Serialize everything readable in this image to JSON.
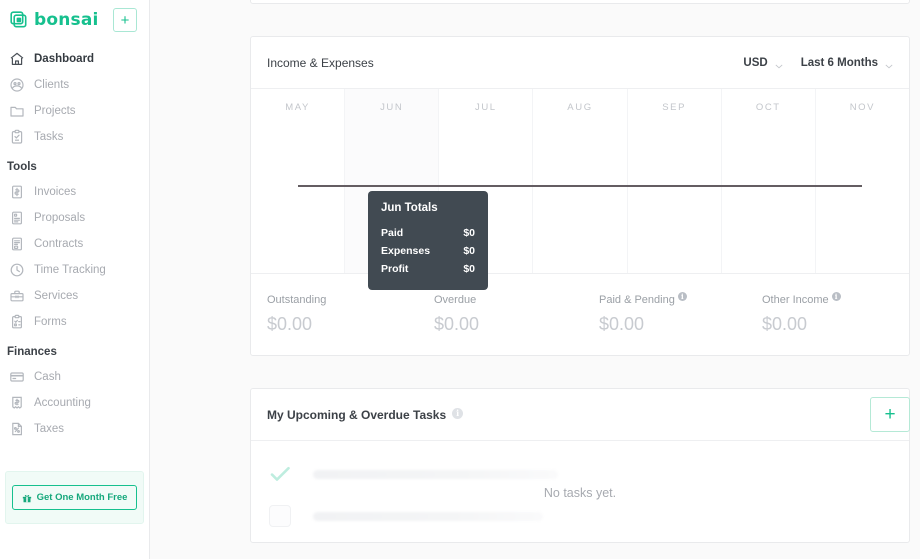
{
  "sidebar": {
    "brand": "bonsai",
    "brand_icon": "bonsai-logo-icon",
    "add_button_label": "+",
    "nav": [
      {
        "label": "Dashboard",
        "icon": "home-icon",
        "active": true
      },
      {
        "label": "Clients",
        "icon": "clients-icon",
        "active": false
      },
      {
        "label": "Projects",
        "icon": "folder-icon",
        "active": false
      },
      {
        "label": "Tasks",
        "icon": "clipboard-check-icon",
        "active": false
      }
    ],
    "tools_title": "Tools",
    "tools": [
      {
        "label": "Invoices",
        "icon": "invoice-icon"
      },
      {
        "label": "Proposals",
        "icon": "proposal-icon"
      },
      {
        "label": "Contracts",
        "icon": "contract-icon"
      },
      {
        "label": "Time Tracking",
        "icon": "clock-icon"
      },
      {
        "label": "Services",
        "icon": "toolbox-icon"
      },
      {
        "label": "Forms",
        "icon": "form-icon"
      }
    ],
    "finances_title": "Finances",
    "finances": [
      {
        "label": "Cash",
        "icon": "credit-card-icon"
      },
      {
        "label": "Accounting",
        "icon": "accounting-icon"
      },
      {
        "label": "Taxes",
        "icon": "tax-percent-icon"
      }
    ],
    "promo_label": "Get One Month Free",
    "promo_icon": "gift-icon"
  },
  "chart_card": {
    "title": "Income & Expenses",
    "currency": "USD",
    "range": "Last 6 Months",
    "currency_caret": "chevron-down-icon",
    "range_caret": "chevron-down-icon",
    "stats": [
      {
        "label": "Outstanding",
        "value": "$0.00",
        "info": false
      },
      {
        "label": "Overdue",
        "value": "$0.00",
        "info": false
      },
      {
        "label": "Paid & Pending",
        "value": "$0.00",
        "info": true
      },
      {
        "label": "Other Income",
        "value": "$0.00",
        "info": true
      }
    ],
    "tooltip": {
      "title": "Jun Totals",
      "rows": [
        {
          "label": "Paid",
          "value": "$0"
        },
        {
          "label": "Expenses",
          "value": "$0"
        },
        {
          "label": "Profit",
          "value": "$0"
        }
      ]
    }
  },
  "chart_data": {
    "type": "bar",
    "title": "Income & Expenses",
    "xlabel": "",
    "ylabel": "",
    "categories": [
      "MAY",
      "JUN",
      "JUL",
      "AUG",
      "SEP",
      "OCT",
      "NOV"
    ],
    "series": [
      {
        "name": "Paid",
        "values": [
          0,
          0,
          0,
          0,
          0,
          0,
          0
        ]
      },
      {
        "name": "Expenses",
        "values": [
          0,
          0,
          0,
          0,
          0,
          0,
          0
        ]
      },
      {
        "name": "Profit",
        "values": [
          0,
          0,
          0,
          0,
          0,
          0,
          0
        ]
      }
    ],
    "ylim": [
      0,
      0
    ],
    "grid": true,
    "legend": "none",
    "currency": "USD",
    "range": "Last 6 Months",
    "highlighted_category": "JUN",
    "zero_baseline": true
  },
  "tasks_card": {
    "title": "My Upcoming & Overdue Tasks",
    "info_icon": "info-icon",
    "add_label": "+",
    "empty_text": "No tasks yet."
  }
}
